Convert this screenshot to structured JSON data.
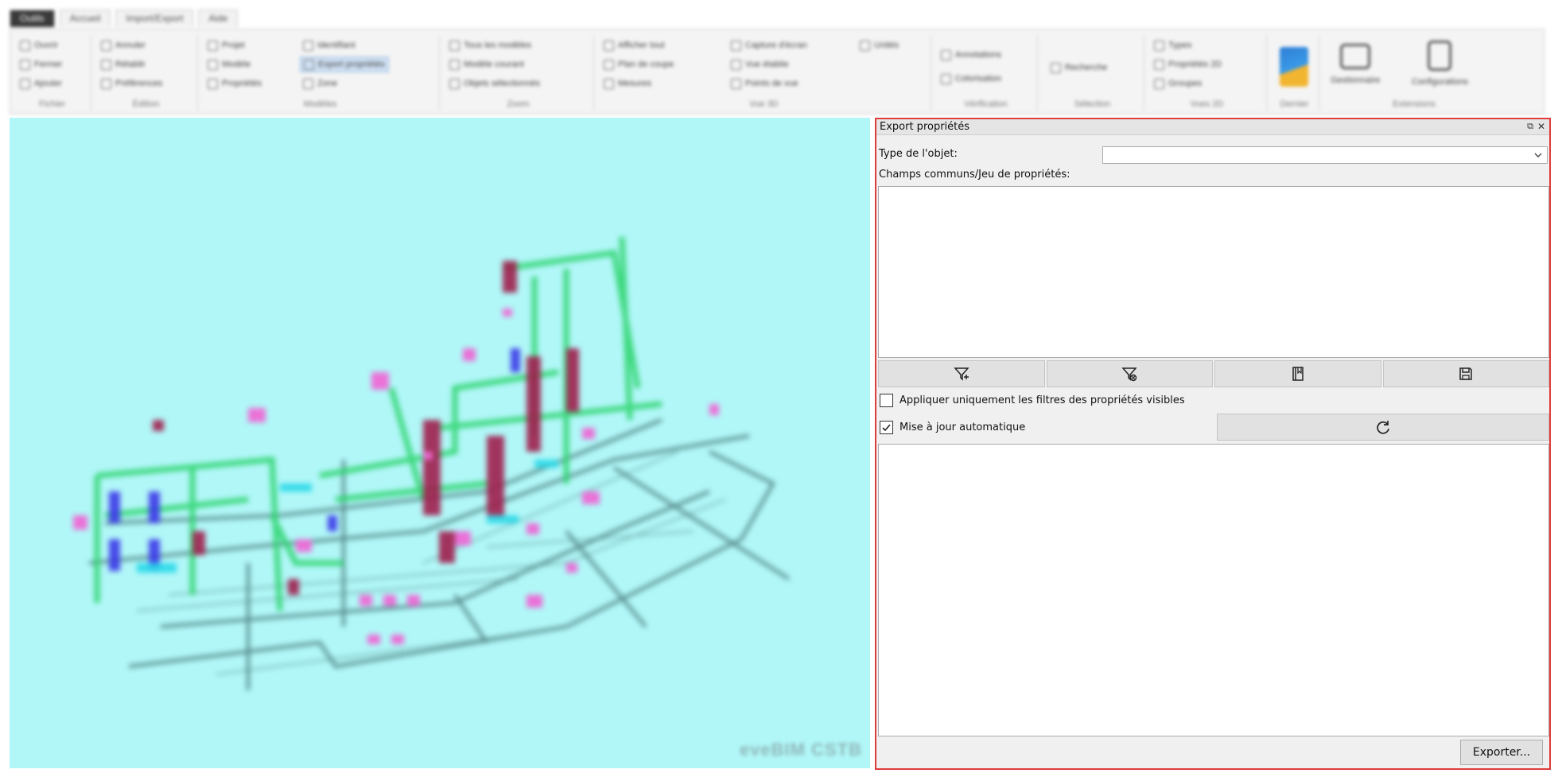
{
  "ribbon": {
    "tabs": [
      "Outils",
      "Accueil",
      "Import/Export",
      "Aide"
    ],
    "active_tab": "Outils",
    "groups": [
      {
        "label": "Fichier",
        "items": [
          "Ouvrir",
          "Fermer",
          "Ajouter"
        ]
      },
      {
        "label": "Édition",
        "items": [
          "Annuler",
          "Rétablir",
          "Préférences"
        ]
      },
      {
        "label": "Modèles",
        "items": [
          "Projet",
          "Modèle",
          "Propriétés",
          "Identifiant",
          "Export propriétés",
          "Zone"
        ]
      },
      {
        "label": "Zoom",
        "items": [
          "Tous les modèles",
          "Modèle courant",
          "Objets sélectionnés"
        ]
      },
      {
        "label": "Vue 3D",
        "items": [
          "Afficher tout",
          "Plan de coupe",
          "Mesures",
          "Capture d'écran",
          "Vue établie",
          "Points de vue",
          "Unités"
        ]
      },
      {
        "label": "Vérification",
        "items": [
          "Annotations",
          "Colorisation"
        ]
      },
      {
        "label": "Sélection",
        "items": [
          "Recherche"
        ]
      },
      {
        "label": "Vues 2D",
        "items": [
          "Types",
          "Propriétés 2D",
          "Groupes"
        ]
      },
      {
        "label": "Dernier",
        "items": []
      },
      {
        "label": "Extensions",
        "items": [
          "Gestionnaire",
          "Configurations"
        ]
      }
    ],
    "highlighted_item": "Export propriétés"
  },
  "viewport": {
    "background": "#b1f7f8",
    "watermark": "eveBIM CSTB"
  },
  "panel": {
    "title": "Export propriétés",
    "type_label": "Type de l'objet:",
    "type_value": "",
    "fields_label": "Champs communs/Jeu de propriétés:",
    "toolbar_icons": [
      "filter-add-icon",
      "filter-remove-icon",
      "book-icon",
      "save-icon"
    ],
    "apply_visible_label": "Appliquer uniquement les filtres des propriétés visibles",
    "apply_visible_checked": false,
    "auto_update_label": "Mise à jour automatique",
    "auto_update_checked": true,
    "export_label": "Exporter...",
    "border_color": "#e03b3b"
  }
}
